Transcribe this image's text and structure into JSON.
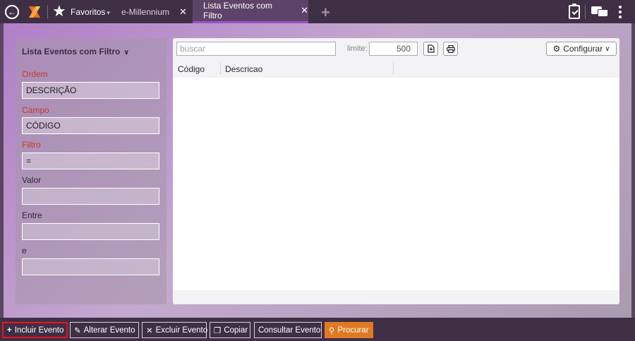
{
  "topbar": {
    "favorites_label": "Favoritos",
    "tabs": [
      {
        "label": "e-Millennium",
        "close": "✕"
      },
      {
        "label": "Lista Eventos com Filtro",
        "close": "✕"
      }
    ]
  },
  "filter_panel": {
    "title": "Lista Eventos com Filtro",
    "ordem_label": "Ordem",
    "ordem_value": "DESCRIÇÃO",
    "campo_label": "Campo",
    "campo_value": "CÓDIGO",
    "filtro_label": "Filtro",
    "filtro_value": "=",
    "valor_label": "Valor",
    "entre_label": "Entre",
    "e_label": "e"
  },
  "grid": {
    "search_placeholder": "buscar",
    "limite_label": "limite:",
    "limite_value": "500",
    "configurar_label": "Configurar",
    "columns": [
      "Código",
      "Descricao"
    ]
  },
  "actions": {
    "incluir": "Incluir Evento",
    "alterar": "Alterar Evento",
    "excluir": "Excluir Evento",
    "copiar": "Copiar",
    "consultar": "Consultar Evento",
    "procurar": "Procurar"
  },
  "colors": {
    "topbar_bg": "#3e2f45",
    "active_tab_underline": "#9c4fd0",
    "required_label": "#c33a2c",
    "procurar_bg": "#e07a22",
    "highlight_border": "#e8141e"
  }
}
